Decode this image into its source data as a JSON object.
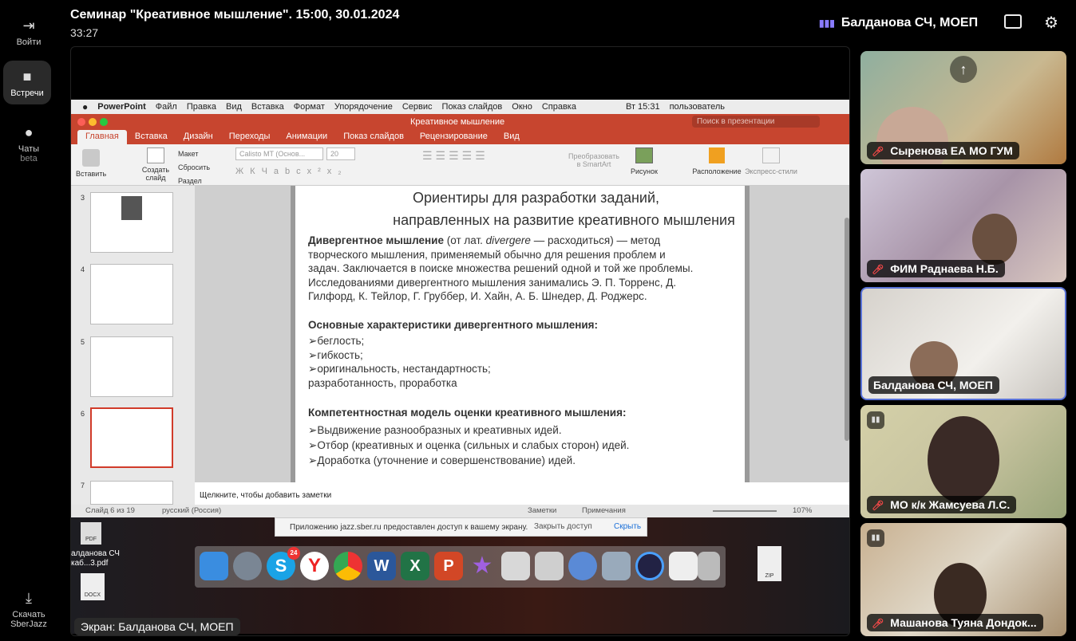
{
  "leftbar": {
    "login": "Войти",
    "meetings": "Встречи",
    "chats": "Чаты",
    "chats_beta": "beta",
    "download": "Скачать",
    "download2": "SberJazz"
  },
  "header": {
    "title": "Семинар \"Креативное мышление\". 15:00, 30.01.2024",
    "timer": "33:27",
    "speaker": "Балданова СЧ, МОЕП"
  },
  "mac_menu": [
    "PowerPoint",
    "Файл",
    "Правка",
    "Вид",
    "Вставка",
    "Формат",
    "Упорядочение",
    "Сервис",
    "Показ слайдов",
    "Окно",
    "Справка"
  ],
  "mac_status": {
    "time": "Вт 15:31",
    "user": "пользователь"
  },
  "ppt": {
    "doc_title": "Креативное мышление",
    "search_placeholder": "Поиск в презентации",
    "tabs": [
      "Главная",
      "Вставка",
      "Дизайн",
      "Переходы",
      "Анимации",
      "Показ слайдов",
      "Рецензирование",
      "Вид"
    ],
    "ribbon": {
      "paste": "Вставить",
      "create_slide": "Создать",
      "create_slide2": "слайд",
      "layout": "Макет",
      "reset": "Сбросить",
      "section": "Раздел",
      "font": "Calisto MT (Основ...",
      "font_size": "20",
      "smartart": "Преобразовать",
      "smartart2": "в SmartArt",
      "picture": "Рисунок",
      "arrange": "Расположение",
      "styles": "Экспресс-стили"
    },
    "thumb_numbers": [
      "3",
      "4",
      "5",
      "6",
      "7"
    ],
    "slide": {
      "title1": "Ориентиры для разработки заданий,",
      "title2": "направленных на развитие креативного мышления",
      "p1_bold": "Дивергентное мышление",
      "p1_a": " (от лат. ",
      "p1_italic": "divergere",
      "p1_b": " — расходиться) — метод",
      "p2": "творческого мышления, применяемый обычно для решения проблем и",
      "p3": "задач. Заключается в поиске множества решений одной и той же проблемы.",
      "p4": "Исследованиями дивергентного мышления занимались Э. П. Торренс, Д.",
      "p5": "Гилфорд, К. Тейлор, Г. Груббер, И. Хайн, А. Б. Шнедер, Д. Роджерс.",
      "h2": "Основные характеристики дивергентного мышления:",
      "c1": "беглость;",
      "c2": "гибкость;",
      "c3": "оригинальность, нестандартность;",
      "c4": "разработанность, проработка",
      "h3": "Компетентностная модель оценки креативного мышления:",
      "m1": "Выдвижение разнообразных и креативных идей.",
      "m2": "Отбор (креативных и оценка (сильных и слабых сторон) идей.",
      "m3": "Доработка (уточнение и совершенствование) идей."
    },
    "notes": "Щелкните, чтобы добавить заметки",
    "status_slide": "Слайд 6 из 19",
    "status_lang": "русский (Россия)",
    "status_notes": "Заметки",
    "status_comments": "Примечания",
    "zoom": "107%"
  },
  "share_bar": {
    "text": "Приложению jazz.sber.ru предоставлен доступ к вашему экрану.",
    "stop": "Закрыть доступ",
    "hide": "Скрыть"
  },
  "desktop_files": {
    "pdf": "PDF",
    "file_name1": "алданова СЧ",
    "file_name2": "каб...3.pdf",
    "docx": "DOCX",
    "zip": "ZIP"
  },
  "dock_badge": "24",
  "screen_label": "Экран: Балданова СЧ, МОЕП",
  "participants": [
    {
      "name": "Сыренова ЕА МО ГУМ",
      "muted": true
    },
    {
      "name": "ФИМ Раднаева Н.Б.",
      "muted": true
    },
    {
      "name": "Балданова СЧ, МОЕП",
      "muted": false
    },
    {
      "name": "МО к/к Жамсуева Л.С.",
      "muted": true
    },
    {
      "name": "Машанова Туяна Дондок...",
      "muted": true
    }
  ]
}
